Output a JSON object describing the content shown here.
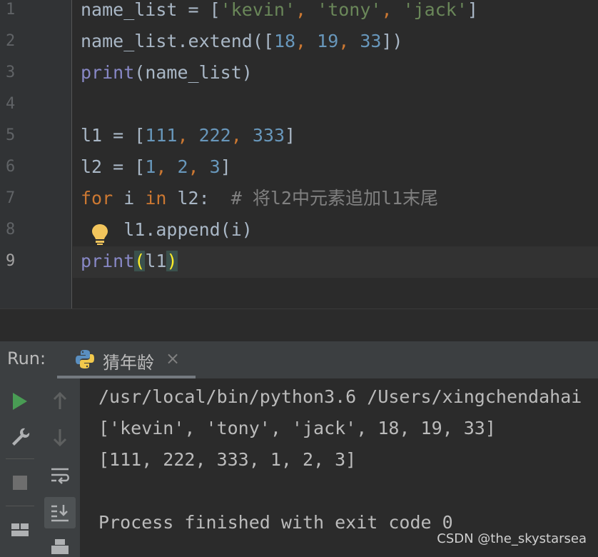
{
  "editor": {
    "line_numbers": [
      "1",
      "2",
      "3",
      "4",
      "5",
      "6",
      "7",
      "8",
      "9"
    ],
    "lines": [
      {
        "segments": [
          {
            "t": "name_list = [",
            "c": ""
          },
          {
            "t": "'kevin'",
            "c": "str"
          },
          {
            "t": ", ",
            "c": "kw"
          },
          {
            "t": "'tony'",
            "c": "str"
          },
          {
            "t": ", ",
            "c": "kw"
          },
          {
            "t": "'jack'",
            "c": "str"
          },
          {
            "t": "]",
            "c": ""
          }
        ]
      },
      {
        "segments": [
          {
            "t": "name_list.extend([",
            "c": ""
          },
          {
            "t": "18",
            "c": "num"
          },
          {
            "t": ", ",
            "c": "kw"
          },
          {
            "t": "19",
            "c": "num"
          },
          {
            "t": ", ",
            "c": "kw"
          },
          {
            "t": "33",
            "c": "num"
          },
          {
            "t": "])",
            "c": ""
          }
        ]
      },
      {
        "segments": [
          {
            "t": "print",
            "c": "bi"
          },
          {
            "t": "(name_list)",
            "c": ""
          }
        ]
      },
      {
        "segments": []
      },
      {
        "segments": [
          {
            "t": "l1 = [",
            "c": ""
          },
          {
            "t": "111",
            "c": "num"
          },
          {
            "t": ", ",
            "c": "kw"
          },
          {
            "t": "222",
            "c": "num"
          },
          {
            "t": ", ",
            "c": "kw"
          },
          {
            "t": "333",
            "c": "num"
          },
          {
            "t": "]",
            "c": ""
          }
        ]
      },
      {
        "segments": [
          {
            "t": "l2 = [",
            "c": ""
          },
          {
            "t": "1",
            "c": "num"
          },
          {
            "t": ", ",
            "c": "kw"
          },
          {
            "t": "2",
            "c": "num"
          },
          {
            "t": ", ",
            "c": "kw"
          },
          {
            "t": "3",
            "c": "num"
          },
          {
            "t": "]",
            "c": ""
          }
        ]
      },
      {
        "segments": [
          {
            "t": "for",
            "c": "kw"
          },
          {
            "t": " i ",
            "c": ""
          },
          {
            "t": "in",
            "c": "kw"
          },
          {
            "t": " l2:  ",
            "c": ""
          },
          {
            "t": "# 将l2中元素追加l1末尾",
            "c": "cm"
          }
        ]
      },
      {
        "segments": [
          {
            "t": "    l1.append(i)",
            "c": ""
          }
        ]
      },
      {
        "segments": [
          {
            "t": "print",
            "c": "bi"
          },
          {
            "t": "(",
            "c": "brk"
          },
          {
            "t": "l1",
            "c": ""
          },
          {
            "t": ")",
            "c": "brk"
          }
        ]
      }
    ]
  },
  "run_panel": {
    "label": "Run:",
    "tab_label": "猜年龄",
    "tab_close": "×",
    "icons": [
      "run-icon",
      "wrench-icon",
      "stop-icon",
      "layout-icon",
      "up-arrow-icon",
      "down-arrow-icon",
      "soft-wrap-icon",
      "scroll-to-end-icon",
      "print-icon"
    ]
  },
  "output": {
    "lines": [
      "/usr/local/bin/python3.6 /Users/xingchendahai",
      "['kevin', 'tony', 'jack', 18, 19, 33]",
      "[111, 222, 333, 1, 2, 3]",
      "",
      "Process finished with exit code 0"
    ]
  },
  "watermark": "CSDN @the_skystarsea"
}
